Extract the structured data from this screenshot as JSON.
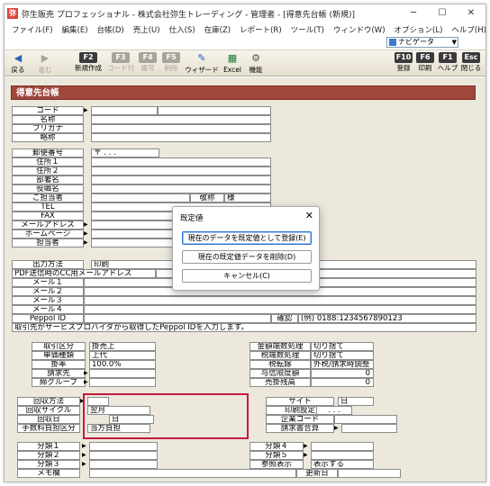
{
  "app": {
    "title": "弥生販売 プロフェッショナル - 株式会社弥生トレーディング - 管理者 - [得意先台帳 (新規)]",
    "logo_text": "弥",
    "window_controls": [
      "─",
      "☐",
      "✕"
    ]
  },
  "menu": [
    "ファイル(F)",
    "編集(E)",
    "台帳(D)",
    "売上(U)",
    "仕入(S)",
    "在庫(Z)",
    "レポート(R)",
    "ツール(T)",
    "ウィンドウ(W)",
    "オプション(L)",
    "ヘルプ(H)"
  ],
  "navigator": {
    "value": "ナビゲータ"
  },
  "toolbar": {
    "left": [
      {
        "label": "戻る",
        "icon": "◀",
        "key": "",
        "icon_name": "back-arrow-icon",
        "disabled": false
      },
      {
        "label": "進む",
        "icon": "▶",
        "key": "",
        "icon_name": "forward-arrow-icon",
        "disabled": true
      },
      {
        "label": "新規作成",
        "icon": "",
        "key": "F2",
        "disabled": false
      },
      {
        "label": "コード付",
        "icon": "",
        "key": "F3",
        "disabled": true
      },
      {
        "label": "複写",
        "icon": "",
        "key": "F4",
        "disabled": true
      },
      {
        "label": "削除",
        "icon": "",
        "key": "F5",
        "disabled": true
      },
      {
        "label": "ウィザード",
        "icon": "✎",
        "key": "",
        "icon_name": "wizard-icon",
        "disabled": false
      },
      {
        "label": "Excel",
        "icon": "▦",
        "key": "",
        "icon_name": "excel-icon",
        "disabled": false
      },
      {
        "label": "機能",
        "icon": "⚙",
        "key": "",
        "icon_name": "function-icon",
        "disabled": false
      }
    ],
    "right": [
      {
        "label": "登録",
        "key": "F10"
      },
      {
        "label": "印刷",
        "key": "F6"
      },
      {
        "label": "ヘルプ",
        "key": "F1"
      },
      {
        "label": "閉じる",
        "key": "Esc"
      }
    ]
  },
  "form": {
    "title": "得意先台帳",
    "labels": {
      "code": "コード",
      "name": "名称",
      "furigana": "フリガナ",
      "short_name": "略称",
      "postal": "郵便番号",
      "postal_value": "〒 . . .",
      "address1": "住所１",
      "address2": "住所２",
      "dept": "部署名",
      "position": "役職名",
      "contact": "ご担当者",
      "honorific": "敬称",
      "honorific_value": "様",
      "tel": "TEL",
      "fax": "FAX",
      "email_address": "メールアドレス",
      "homepage": "ホームページ",
      "staff": "担当者",
      "output_method": "出力方法",
      "output_method_value": "印刷",
      "pdf_cc": "PDF送信時のCC用メールアドレス",
      "mail1": "メール１",
      "mail2": "メール２",
      "mail3": "メール３",
      "mail4": "メール４",
      "peppol": "Peppol ID",
      "confirm": "確認",
      "peppol_example": "(例) 0188:1234567890123",
      "peppol_note": "取引先がサービスプロバイダから取得したPeppol IDを入力します。",
      "trade_type": "取引区分",
      "trade_type_value": "掛売上",
      "unit_price_type": "単価種類",
      "unit_price_value": "上代",
      "rate": "掛率",
      "rate_value": "100.0%",
      "billing_to": "請求先",
      "closing_group": "締グループ",
      "amount_rounding": "金額端数処理",
      "amount_rounding_value": "切り捨て",
      "tax_rounding": "税端数処理",
      "tax_rounding_value": "切り捨て",
      "tax_conversion": "税転嫁",
      "tax_conversion_value": "外税/請求時調整",
      "credit_limit": "与信限度額",
      "credit_limit_value": "0",
      "ar_balance": "売掛残高",
      "ar_balance_value": "0",
      "collection_method": "回収方法",
      "collection_cycle": "回収サイクル",
      "collection_cycle_value": "翌月",
      "collection_day": "回収日",
      "collection_day_value": "日",
      "fee_bearer": "手数料負担区分",
      "fee_bearer_value": "当方負担",
      "site": "サイト",
      "site_value": "日",
      "print_settings": "印刷設定",
      "print_settings_value": ". . .",
      "company_code": "企業コード",
      "invoice_merge": "請求書合算",
      "cat1": "分類１",
      "cat2": "分類２",
      "cat3": "分類３",
      "cat4": "分類４",
      "cat5": "分類５",
      "memo": "メモ欄",
      "reference_display": "参照表示",
      "reference_display_value": "表示する",
      "updated_date": "更新日"
    }
  },
  "dialog": {
    "title": "既定値",
    "close": "✕",
    "buttons": [
      "現在のデータを既定値として登録(E)",
      "現在の既定値データを削除(D)",
      "キャンセル(C)"
    ]
  },
  "colors": {
    "form_title_bg": "#a0473c",
    "highlight": "#c41a3c",
    "dialog_focus": "#2f6fd1"
  }
}
